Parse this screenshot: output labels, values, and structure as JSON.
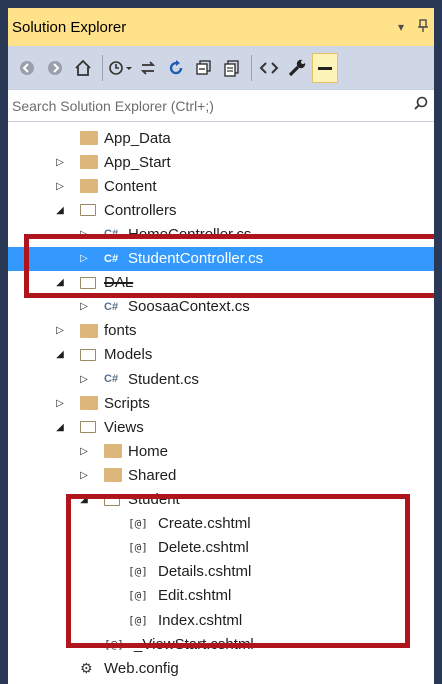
{
  "panel": {
    "title": "Solution Explorer",
    "dropdown_glyph": "▾",
    "pin_glyph": "⊥"
  },
  "toolbar": {
    "icons": [
      "back-icon",
      "forward-icon",
      "home-icon",
      "history-icon",
      "sync-icon",
      "refresh-icon",
      "collapse-all-icon",
      "show-all-files-icon",
      "view-code-icon",
      "properties-icon",
      "preview-icon"
    ]
  },
  "search": {
    "placeholder": "Search Solution Explorer (Ctrl+;)",
    "search_glyph": "⌕"
  },
  "tree": [
    {
      "label": "App_Data",
      "icon": "folder-icon",
      "expander": "none",
      "depth": 1
    },
    {
      "label": "App_Start",
      "icon": "folder-icon",
      "expander": "collapsed",
      "depth": 1
    },
    {
      "label": "Content",
      "icon": "folder-icon",
      "expander": "collapsed",
      "depth": 1
    },
    {
      "label": "Controllers",
      "icon": "folder-open-icon",
      "expander": "expanded",
      "depth": 1
    },
    {
      "label": "HomeController.cs",
      "icon": "csharp-file-icon",
      "expander": "collapsed",
      "depth": 2,
      "partially_hidden": true
    },
    {
      "label": "StudentController.cs",
      "icon": "csharp-file-icon",
      "expander": "collapsed",
      "depth": 2,
      "selected": true
    },
    {
      "label": "DAL",
      "icon": "folder-open-icon",
      "expander": "expanded",
      "depth": 1,
      "partially_hidden": true
    },
    {
      "label": "SoosaaContext.cs",
      "icon": "csharp-file-icon",
      "expander": "collapsed",
      "depth": 2
    },
    {
      "label": "fonts",
      "icon": "folder-icon",
      "expander": "collapsed",
      "depth": 1
    },
    {
      "label": "Models",
      "icon": "folder-open-icon",
      "expander": "expanded",
      "depth": 1
    },
    {
      "label": "Student.cs",
      "icon": "csharp-file-icon",
      "expander": "collapsed",
      "depth": 2
    },
    {
      "label": "Scripts",
      "icon": "folder-icon",
      "expander": "collapsed",
      "depth": 1
    },
    {
      "label": "Views",
      "icon": "folder-open-icon",
      "expander": "expanded",
      "depth": 1
    },
    {
      "label": "Home",
      "icon": "folder-icon",
      "expander": "collapsed",
      "depth": 2
    },
    {
      "label": "Shared",
      "icon": "folder-icon",
      "expander": "collapsed",
      "depth": 2
    },
    {
      "label": "Student",
      "icon": "folder-open-icon",
      "expander": "expanded",
      "depth": 2
    },
    {
      "label": "Create.cshtml",
      "icon": "razor-file-icon",
      "expander": "none",
      "depth": 3
    },
    {
      "label": "Delete.cshtml",
      "icon": "razor-file-icon",
      "expander": "none",
      "depth": 3
    },
    {
      "label": "Details.cshtml",
      "icon": "razor-file-icon",
      "expander": "none",
      "depth": 3
    },
    {
      "label": "Edit.cshtml",
      "icon": "razor-file-icon",
      "expander": "none",
      "depth": 3
    },
    {
      "label": "Index.cshtml",
      "icon": "razor-file-icon",
      "expander": "none",
      "depth": 3
    },
    {
      "label": "_ViewStart.cshtml",
      "icon": "razor-file-icon",
      "expander": "none",
      "depth": 2
    },
    {
      "label": "Web.config",
      "icon": "config-file-icon",
      "expander": "none",
      "depth": 1
    }
  ],
  "glyphs": {
    "csharp": "C#",
    "razor": "[@]",
    "config": "⚙",
    "collapsed": "▷",
    "expanded": "◢"
  },
  "colors": {
    "title_bar": "#ffe28a",
    "toolbar": "#cfd6e5",
    "selection": "#3399ff",
    "annotation_box": "#b0151d",
    "folder": "#dcb67a"
  }
}
